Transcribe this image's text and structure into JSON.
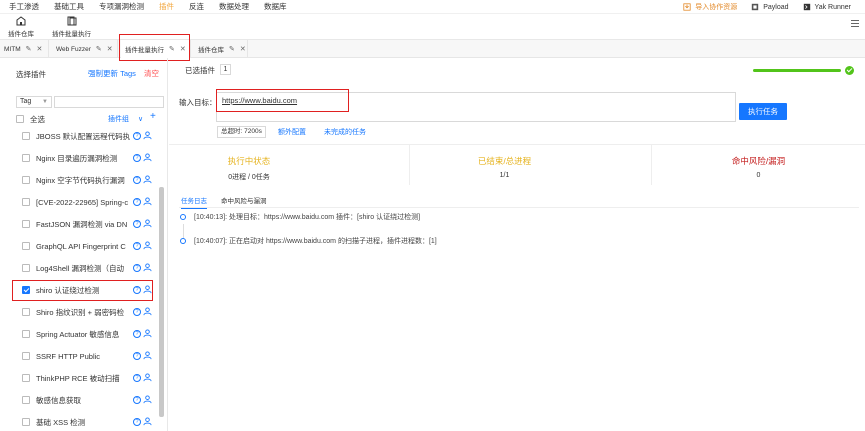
{
  "menu": {
    "items": [
      "手工渗透",
      "基础工具",
      "专项漏洞检测",
      "插件",
      "反连",
      "数据处理",
      "数据库"
    ],
    "active_index": 3,
    "import_label": "导入协作资源",
    "payload_label": "Payload",
    "yak_label": "Yak Runner"
  },
  "toolbar": {
    "items": [
      "插件仓库",
      "插件批量执行"
    ]
  },
  "tabs": [
    {
      "label": "MITM"
    },
    {
      "label": "Web Fuzzer"
    },
    {
      "label": "插件批量执行"
    },
    {
      "label": "插件仓库"
    }
  ],
  "active_tab_index": 2,
  "left": {
    "title": "选择插件",
    "force_update": "强制更新 Tags",
    "clear": "清空",
    "tag_select": "Tag",
    "select_all": "全选",
    "plugin_group": "插件组",
    "plugins": [
      {
        "name": "JBOSS 默认配置远程代码执",
        "checked": false
      },
      {
        "name": "Nginx 目录遍历漏洞检测",
        "checked": false
      },
      {
        "name": "Nginx 空字节代码执行漏洞",
        "checked": false
      },
      {
        "name": "[CVE-2022-22965] Spring-c",
        "checked": false
      },
      {
        "name": "FastJSON 漏洞检测 via DN",
        "checked": false
      },
      {
        "name": "GraphQL API Fingerprint C",
        "checked": false
      },
      {
        "name": "Log4Shell 漏洞检测（自动",
        "checked": false
      },
      {
        "name": "shiro 认证绕过检测",
        "checked": true
      },
      {
        "name": "Shiro 指纹识别 + 弱密码检",
        "checked": false
      },
      {
        "name": "Spring Actuator 敏感信息",
        "checked": false
      },
      {
        "name": "SSRF HTTP Public",
        "checked": false
      },
      {
        "name": "ThinkPHP RCE 被动扫描",
        "checked": false
      },
      {
        "name": "敏感信息获取",
        "checked": false
      },
      {
        "name": "基础 XSS 检测",
        "checked": false
      }
    ]
  },
  "main": {
    "selected_label": "已选插件",
    "selected_count": "1",
    "progress_percent": 100,
    "target_label": "输入目标：",
    "target_value": "https://www.baidu.com",
    "run_button": "执行任务",
    "timeout": "总超时: 7200s",
    "extra_config": "额外配置",
    "unfinished": "未完成的任务",
    "stats": [
      {
        "title": "执行中状态",
        "value": "0进程 / 0任务",
        "color": "#e6b422"
      },
      {
        "title": "已结束/总进程",
        "value": "1/1",
        "color": "#e6b422"
      },
      {
        "title": "命中风险/漏洞",
        "value": "0",
        "color": "#c41d1d"
      }
    ],
    "subtabs": [
      "任务日志",
      "命中风险与漏洞"
    ],
    "logs": [
      "[10:40:13]: 处理目标：https://www.baidu.com 插件：[shiro 认证绕过检测]",
      "[10:40:07]: 正在启动对 https://www.baidu.com 的扫描子进程，插件进程数：[1]"
    ]
  }
}
